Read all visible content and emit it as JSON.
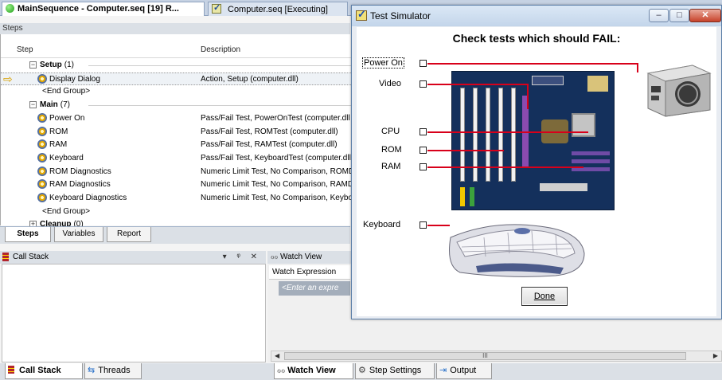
{
  "doc_tabs": [
    {
      "label": "MainSequence - Computer.seq [19]  R..."
    },
    {
      "label": "Computer.seq [Executing]"
    }
  ],
  "steps_pane": {
    "title": "Steps",
    "col_step": "Step",
    "col_description": "Description",
    "rows": [
      {
        "kind": "group",
        "step": "Setup",
        "count": "(1)",
        "desc": ""
      },
      {
        "kind": "step",
        "step": "Display Dialog",
        "desc": "Action,  Setup (computer.dll)",
        "current": true
      },
      {
        "kind": "end",
        "step": "<End Group>",
        "desc": ""
      },
      {
        "kind": "group",
        "step": "Main",
        "count": "(7)",
        "desc": ""
      },
      {
        "kind": "step",
        "step": "Power On",
        "desc": "Pass/Fail Test,  PowerOnTest (computer.dll"
      },
      {
        "kind": "step",
        "step": "ROM",
        "desc": "Pass/Fail Test,  ROMTest (computer.dll)"
      },
      {
        "kind": "step",
        "step": "RAM",
        "desc": "Pass/Fail Test,  RAMTest (computer.dll)"
      },
      {
        "kind": "step",
        "step": "Keyboard",
        "desc": "Pass/Fail Test,  KeyboardTest (computer.dll"
      },
      {
        "kind": "step",
        "step": "ROM Diagnostics",
        "desc": "Numeric Limit Test,  No Comparison, ROMD"
      },
      {
        "kind": "step",
        "step": "RAM Diagnostics",
        "desc": "Numeric Limit Test,  No Comparison, RAMD"
      },
      {
        "kind": "step",
        "step": "Keyboard Diagnostics",
        "desc": "Numeric Limit Test,  No Comparison, Keybo"
      },
      {
        "kind": "end",
        "step": "<End Group>",
        "desc": ""
      },
      {
        "kind": "group",
        "step": "Cleanup",
        "count": "(0)",
        "desc": "",
        "collapsed": true
      }
    ],
    "tabs": [
      "Steps",
      "Variables",
      "Report"
    ]
  },
  "call_stack": {
    "title": "Call Stack",
    "controls": "▾ ᵠ ✕"
  },
  "watch_view": {
    "title": "Watch View",
    "header": "Watch Expression",
    "placeholder": "<Enter an expre",
    "scroll_mark": "III"
  },
  "bottom_left_tabs": [
    "Call Stack",
    "Threads"
  ],
  "bottom_right_tabs": [
    "Watch View",
    "Step Settings",
    "Output"
  ],
  "dialog": {
    "title": "Test Simulator",
    "heading": "Check tests which should FAIL:",
    "labels": {
      "power_on": "Power On",
      "video": "Video",
      "cpu": "CPU",
      "rom": "ROM",
      "ram": "RAM",
      "keyboard": "Keyboard"
    },
    "done_label": "Done",
    "window_buttons": {
      "minimize": "–",
      "maximize": "□",
      "close": "✕"
    }
  },
  "colors": {
    "accent": "#d8001a",
    "tab_strip": "#c6d2e3"
  }
}
